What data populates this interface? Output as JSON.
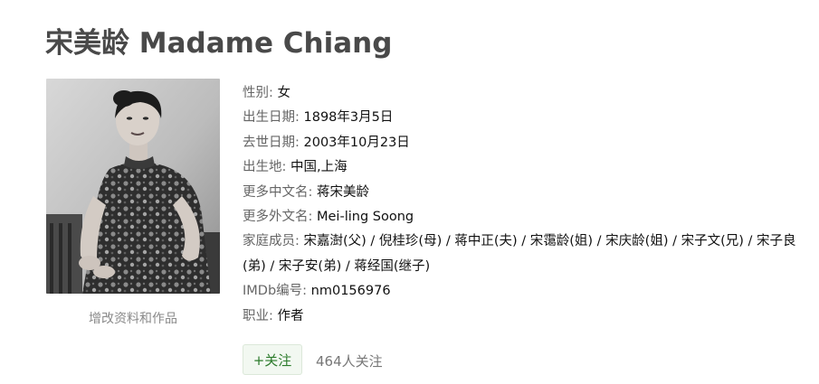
{
  "celebrity": {
    "title": "宋美龄 Madame Chiang",
    "photo": "portrait-photo",
    "edit_link": "增改资料和作品"
  },
  "info": {
    "gender": {
      "label": "性别:",
      "value": "女"
    },
    "birth_date": {
      "label": "出生日期:",
      "value": "1898年3月5日"
    },
    "death_date": {
      "label": "去世日期:",
      "value": "2003年10月23日"
    },
    "birthplace": {
      "label": "出生地:",
      "value": "中国,上海"
    },
    "other_cn_names": {
      "label": "更多中文名:",
      "value": "蒋宋美龄"
    },
    "other_foreign_names": {
      "label": "更多外文名:",
      "value": "Mei-ling Soong"
    },
    "family": {
      "label": "家庭成员:",
      "value": "宋嘉澍(父) / 倪桂珍(母) / 蒋中正(夫) / 宋霭龄(姐) / 宋庆龄(姐) / 宋子文(兄) / 宋子良(弟) / 宋子安(弟) / 蒋经国(继子)"
    },
    "imdb": {
      "label": "IMDb编号:",
      "value": "nm0156976"
    },
    "occupation": {
      "label": "职业:",
      "value": "作者"
    }
  },
  "follow": {
    "button_label": "+关注",
    "count_text": "464人关注"
  }
}
